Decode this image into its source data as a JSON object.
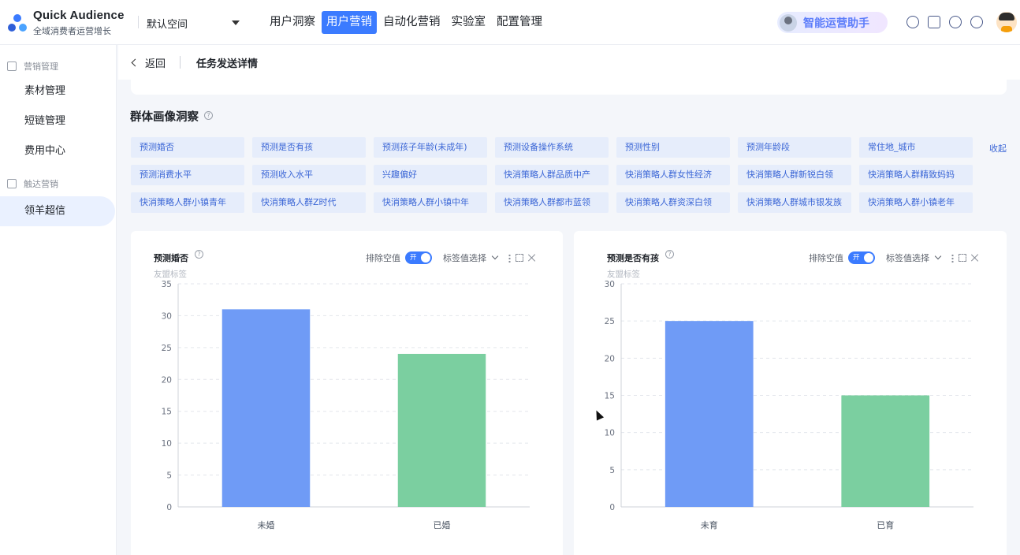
{
  "brand": {
    "name": "Quick Audience",
    "subtitle": "全域消费者运营增长"
  },
  "workspace": {
    "label": "默认空间"
  },
  "topnav": [
    {
      "label": "用户洞察",
      "active": false
    },
    {
      "label": "用户营销",
      "active": true
    },
    {
      "label": "自动化营销",
      "active": false
    },
    {
      "label": "实验室",
      "active": false
    },
    {
      "label": "配置管理",
      "active": false
    }
  ],
  "assistant": {
    "label": "智能运营助手"
  },
  "header_icons": [
    "ai-icon",
    "toolbox-icon",
    "help-icon",
    "globe-icon"
  ],
  "sidebar": {
    "groups": [
      {
        "label": "营销管理",
        "icon": "layers-icon",
        "items": [
          {
            "label": "素材管理",
            "active": false
          },
          {
            "label": "短链管理",
            "active": false
          },
          {
            "label": "费用中心",
            "active": false
          }
        ]
      },
      {
        "label": "触达营销",
        "icon": "send-icon",
        "items": [
          {
            "label": "领羊超信",
            "active": true
          }
        ]
      }
    ]
  },
  "breadcrumb": {
    "back_label": "返回",
    "title": "任务发送详情"
  },
  "section": {
    "title": "群体画像洞察",
    "collapse_label": "收起"
  },
  "tags": [
    [
      "预测婚否",
      "预测是否有孩",
      "预测孩子年龄(未成年)",
      "预测设备操作系统",
      "预测性别",
      "预测年龄段",
      "常住地_城市"
    ],
    [
      "预测消费水平",
      "预测收入水平",
      "兴趣偏好",
      "快消策略人群品质中产",
      "快消策略人群女性经济",
      "快消策略人群新锐白领",
      "快消策略人群精致妈妈"
    ],
    [
      "快消策略人群小镇青年",
      "快消策略人群Z时代",
      "快消策略人群小镇中年",
      "快消策略人群都市蓝领",
      "快消策略人群资深白领",
      "快消策略人群城市银发族",
      "快消策略人群小镇老年"
    ]
  ],
  "controls": {
    "exclude_null": "排除空值",
    "toggle_on": "开",
    "value_select": "标签值选择"
  },
  "colors": {
    "accent": "#3b7bff",
    "bar_blue": "#6f9bf6",
    "bar_green": "#7bcfa0",
    "tag_bg": "#e6edfb"
  },
  "chart_data": [
    {
      "type": "bar",
      "title": "预测婚否",
      "subtitle": "友盟标签",
      "categories": [
        "未婚",
        "已婚"
      ],
      "values": [
        31,
        24
      ],
      "ylim": [
        0,
        35
      ],
      "yticks": [
        0,
        5,
        10,
        15,
        20,
        25,
        30,
        35
      ],
      "grid": true,
      "bar_colors": [
        "#6f9bf6",
        "#7bcfa0"
      ]
    },
    {
      "type": "bar",
      "title": "预测是否有孩",
      "subtitle": "友盟标签",
      "categories": [
        "未育",
        "已育"
      ],
      "values": [
        25,
        15
      ],
      "ylim": [
        0,
        30
      ],
      "yticks": [
        0,
        5,
        10,
        15,
        20,
        25,
        30
      ],
      "grid": true,
      "bar_colors": [
        "#6f9bf6",
        "#7bcfa0"
      ]
    }
  ]
}
